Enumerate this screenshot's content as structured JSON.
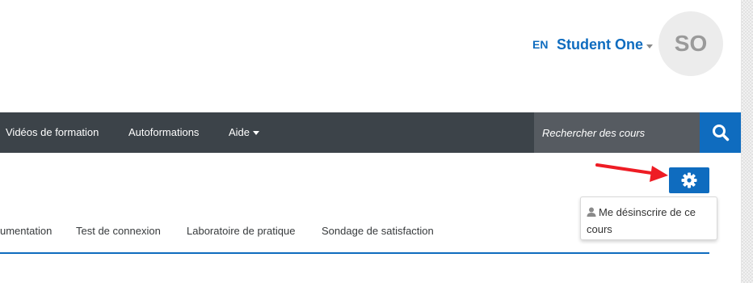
{
  "header": {
    "language": "EN",
    "user_name": "Student One",
    "avatar_initials": "SO"
  },
  "navbar": {
    "items": [
      {
        "label": "Vidéos de formation"
      },
      {
        "label": "Autoformations"
      },
      {
        "label": "Aide"
      }
    ],
    "search_placeholder": "Rechercher des cours"
  },
  "course_menu": {
    "dropdown_item": "Me désinscrire de ce cours"
  },
  "tabs": [
    {
      "label": "umentation"
    },
    {
      "label": "Test de connexion"
    },
    {
      "label": "Laboratoire de pratique"
    },
    {
      "label": "Sondage de satisfaction"
    }
  ],
  "colors": {
    "accent": "#0f6cbf",
    "navbar_bg": "#3c4349",
    "annotation_arrow": "#ee1c24"
  },
  "icons": {
    "search": "search-icon",
    "gear": "gear-icon",
    "user": "user-icon",
    "caret": "chevron-down-icon"
  }
}
